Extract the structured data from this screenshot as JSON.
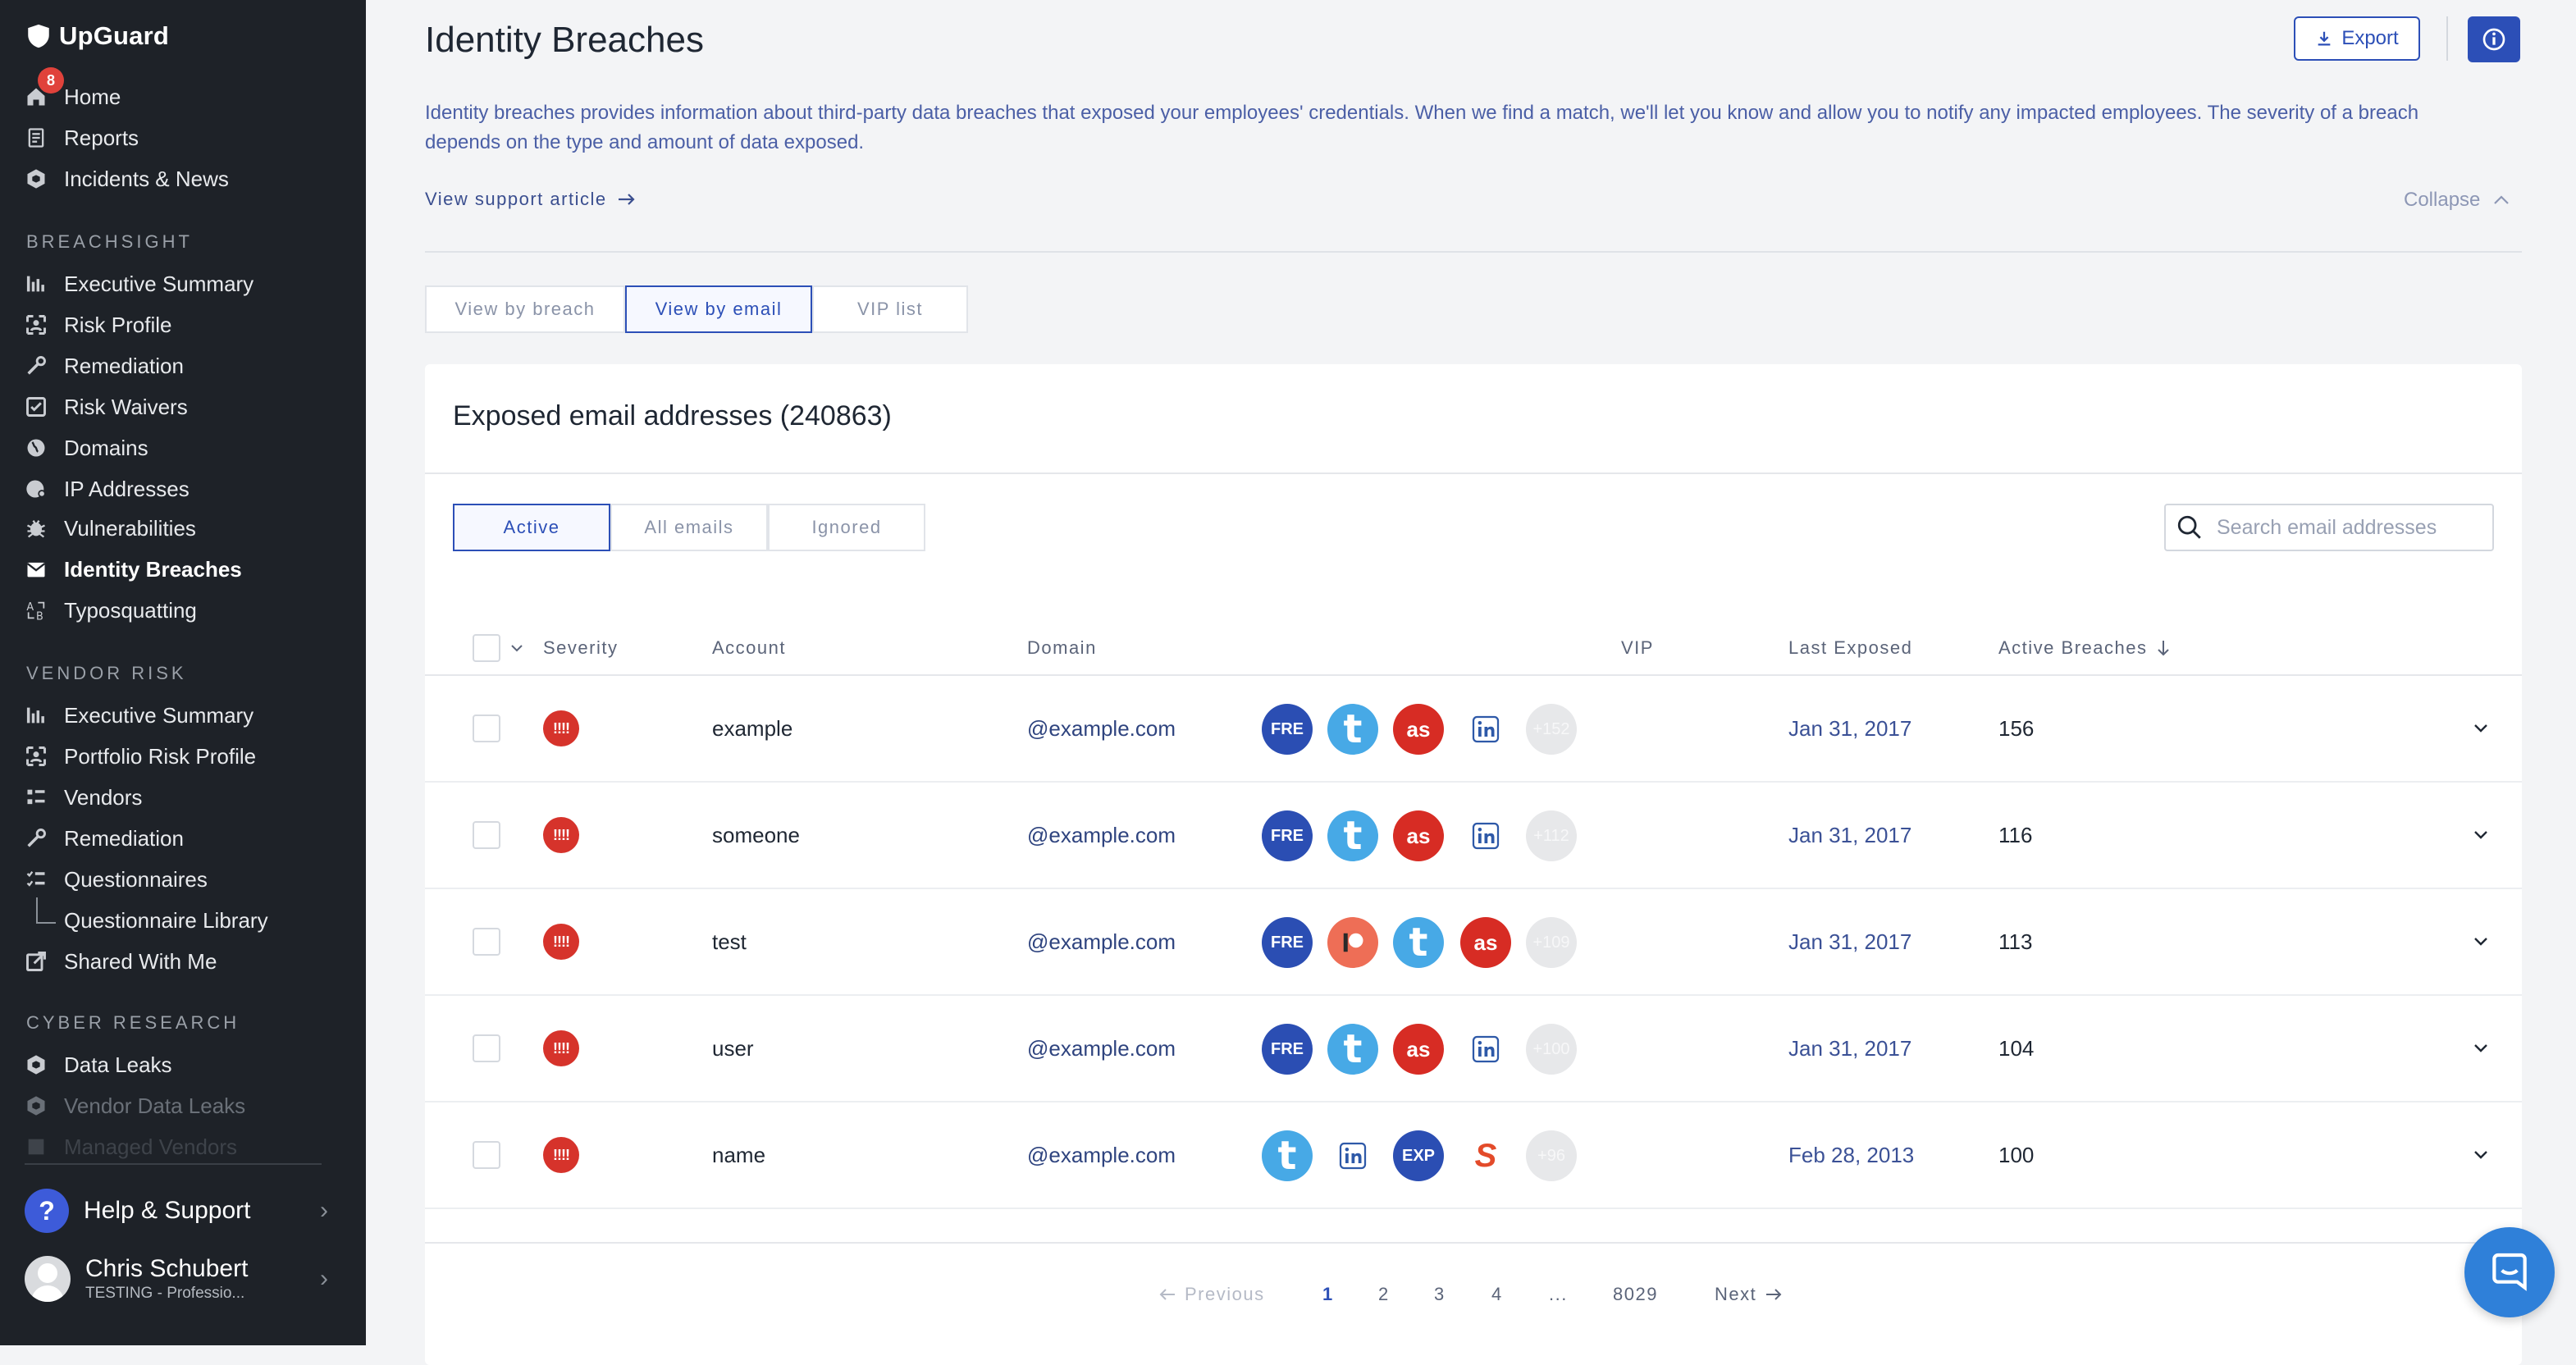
{
  "sidebar": {
    "brand": "UpGuard",
    "home_badge": "8",
    "top_items": [
      {
        "label": "Home",
        "icon": "home-icon"
      },
      {
        "label": "Reports",
        "icon": "report-icon"
      },
      {
        "label": "Incidents & News",
        "icon": "news-icon"
      }
    ],
    "sections": [
      {
        "title": "BREACHSIGHT",
        "items": [
          {
            "label": "Executive Summary"
          },
          {
            "label": "Risk Profile"
          },
          {
            "label": "Remediation"
          },
          {
            "label": "Risk Waivers"
          },
          {
            "label": "Domains"
          },
          {
            "label": "IP Addresses"
          },
          {
            "label": "Vulnerabilities"
          },
          {
            "label": "Identity Breaches"
          },
          {
            "label": "Typosquatting"
          }
        ]
      },
      {
        "title": "VENDOR RISK",
        "items": [
          {
            "label": "Executive Summary"
          },
          {
            "label": "Portfolio Risk Profile"
          },
          {
            "label": "Vendors"
          },
          {
            "label": "Remediation"
          },
          {
            "label": "Questionnaires"
          },
          {
            "label": "Questionnaire Library"
          },
          {
            "label": "Shared With Me"
          }
        ]
      },
      {
        "title": "CYBER RESEARCH",
        "items": [
          {
            "label": "Data Leaks"
          },
          {
            "label": "Vendor Data Leaks"
          },
          {
            "label": "Managed Vendors"
          }
        ]
      }
    ],
    "help_label": "Help & Support",
    "user_name": "Chris Schubert",
    "user_org": "TESTING - Professio..."
  },
  "header": {
    "title": "Identity Breaches",
    "export_label": "Export",
    "intro": "Identity breaches provides information about third-party data breaches that exposed your employees' credentials. When we find a match, we'll let you know and allow you to notify any impacted employees. The severity of a breach depends on the type and amount of data exposed.",
    "support_link": "View support article",
    "collapse_label": "Collapse"
  },
  "view_tabs": [
    {
      "label": "View by breach",
      "selected": false
    },
    {
      "label": "View by email",
      "selected": true
    },
    {
      "label": "VIP list",
      "selected": false
    }
  ],
  "card": {
    "title": "Exposed email addresses (240863)",
    "filter_tabs": [
      {
        "label": "Active",
        "selected": true
      },
      {
        "label": "All emails",
        "selected": false
      },
      {
        "label": "Ignored",
        "selected": false
      }
    ],
    "search_placeholder": "Search email addresses",
    "columns": {
      "severity": "Severity",
      "account": "Account",
      "domain": "Domain",
      "vip": "VIP",
      "last_exposed": "Last Exposed",
      "active_breaches": "Active Breaches"
    },
    "rows": [
      {
        "severity": "!!!!",
        "account": "example",
        "domain": "@example.com",
        "vip": "",
        "last_exposed": "Jan 31, 2017",
        "count": "156",
        "breaches": [
          {
            "type": "fre",
            "label": "FRE"
          },
          {
            "type": "t",
            "label": "t"
          },
          {
            "type": "lastfm",
            "label": "as"
          },
          {
            "type": "li",
            "label": "in"
          },
          {
            "type": "more",
            "label": "+152"
          }
        ]
      },
      {
        "severity": "!!!!",
        "account": "someone",
        "domain": "@example.com",
        "vip": "",
        "last_exposed": "Jan 31, 2017",
        "count": "116",
        "breaches": [
          {
            "type": "fre",
            "label": "FRE"
          },
          {
            "type": "t",
            "label": "t"
          },
          {
            "type": "lastfm",
            "label": "as"
          },
          {
            "type": "li",
            "label": "in"
          },
          {
            "type": "more",
            "label": "+112"
          }
        ]
      },
      {
        "severity": "!!!!",
        "account": "test",
        "domain": "@example.com",
        "vip": "",
        "last_exposed": "Jan 31, 2017",
        "count": "113",
        "breaches": [
          {
            "type": "fre",
            "label": "FRE"
          },
          {
            "type": "patreon",
            "label": ""
          },
          {
            "type": "t",
            "label": "t"
          },
          {
            "type": "lastfm",
            "label": "as"
          },
          {
            "type": "more",
            "label": "+109"
          }
        ]
      },
      {
        "severity": "!!!!",
        "account": "user",
        "domain": "@example.com",
        "vip": "",
        "last_exposed": "Jan 31, 2017",
        "count": "104",
        "breaches": [
          {
            "type": "fre",
            "label": "FRE"
          },
          {
            "type": "t",
            "label": "t"
          },
          {
            "type": "lastfm",
            "label": "as"
          },
          {
            "type": "li",
            "label": "in"
          },
          {
            "type": "more",
            "label": "+100"
          }
        ]
      },
      {
        "severity": "!!!!",
        "account": "name",
        "domain": "@example.com",
        "vip": "",
        "last_exposed": "Feb 28, 2013",
        "count": "100",
        "breaches": [
          {
            "type": "t",
            "label": "t"
          },
          {
            "type": "li",
            "label": "in"
          },
          {
            "type": "exp",
            "label": "EXP"
          },
          {
            "type": "s",
            "label": "S"
          },
          {
            "type": "more",
            "label": "+96"
          }
        ]
      }
    ]
  },
  "pagination": {
    "previous": "Previous",
    "pages": [
      "1",
      "2",
      "3",
      "4",
      "...",
      "8029"
    ],
    "current": "1",
    "next": "Next"
  },
  "colors": {
    "accent": "#2c4fb7",
    "sidebar_bg": "#1e2228",
    "severity_red": "#d6332b"
  }
}
